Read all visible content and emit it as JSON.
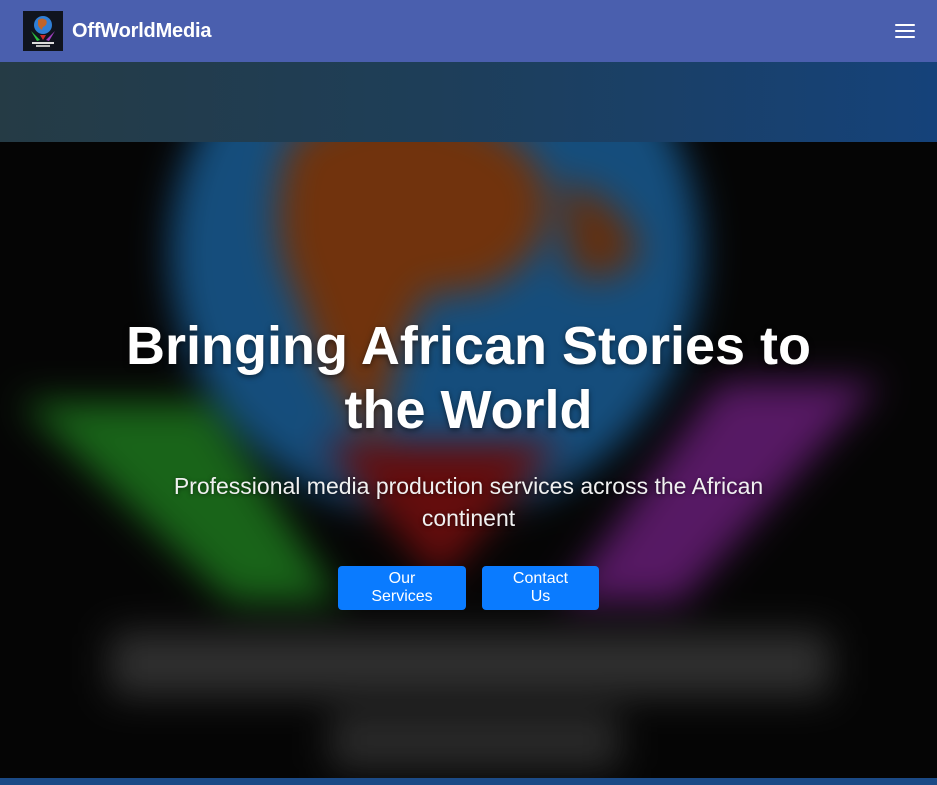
{
  "navbar": {
    "brand": "OffWorldMedia",
    "logo_icon": "globe-logo-icon",
    "menu_icon": "hamburger-menu-icon"
  },
  "hero": {
    "title": "Bringing African Stories to the World",
    "subtitle": "Professional media production services across the African continent",
    "buttons": {
      "services": "Our Services",
      "contact": "Contact Us"
    }
  },
  "colors": {
    "navbar": "#4a5fae",
    "button": "#0a7bff",
    "text": "#ffffff"
  }
}
